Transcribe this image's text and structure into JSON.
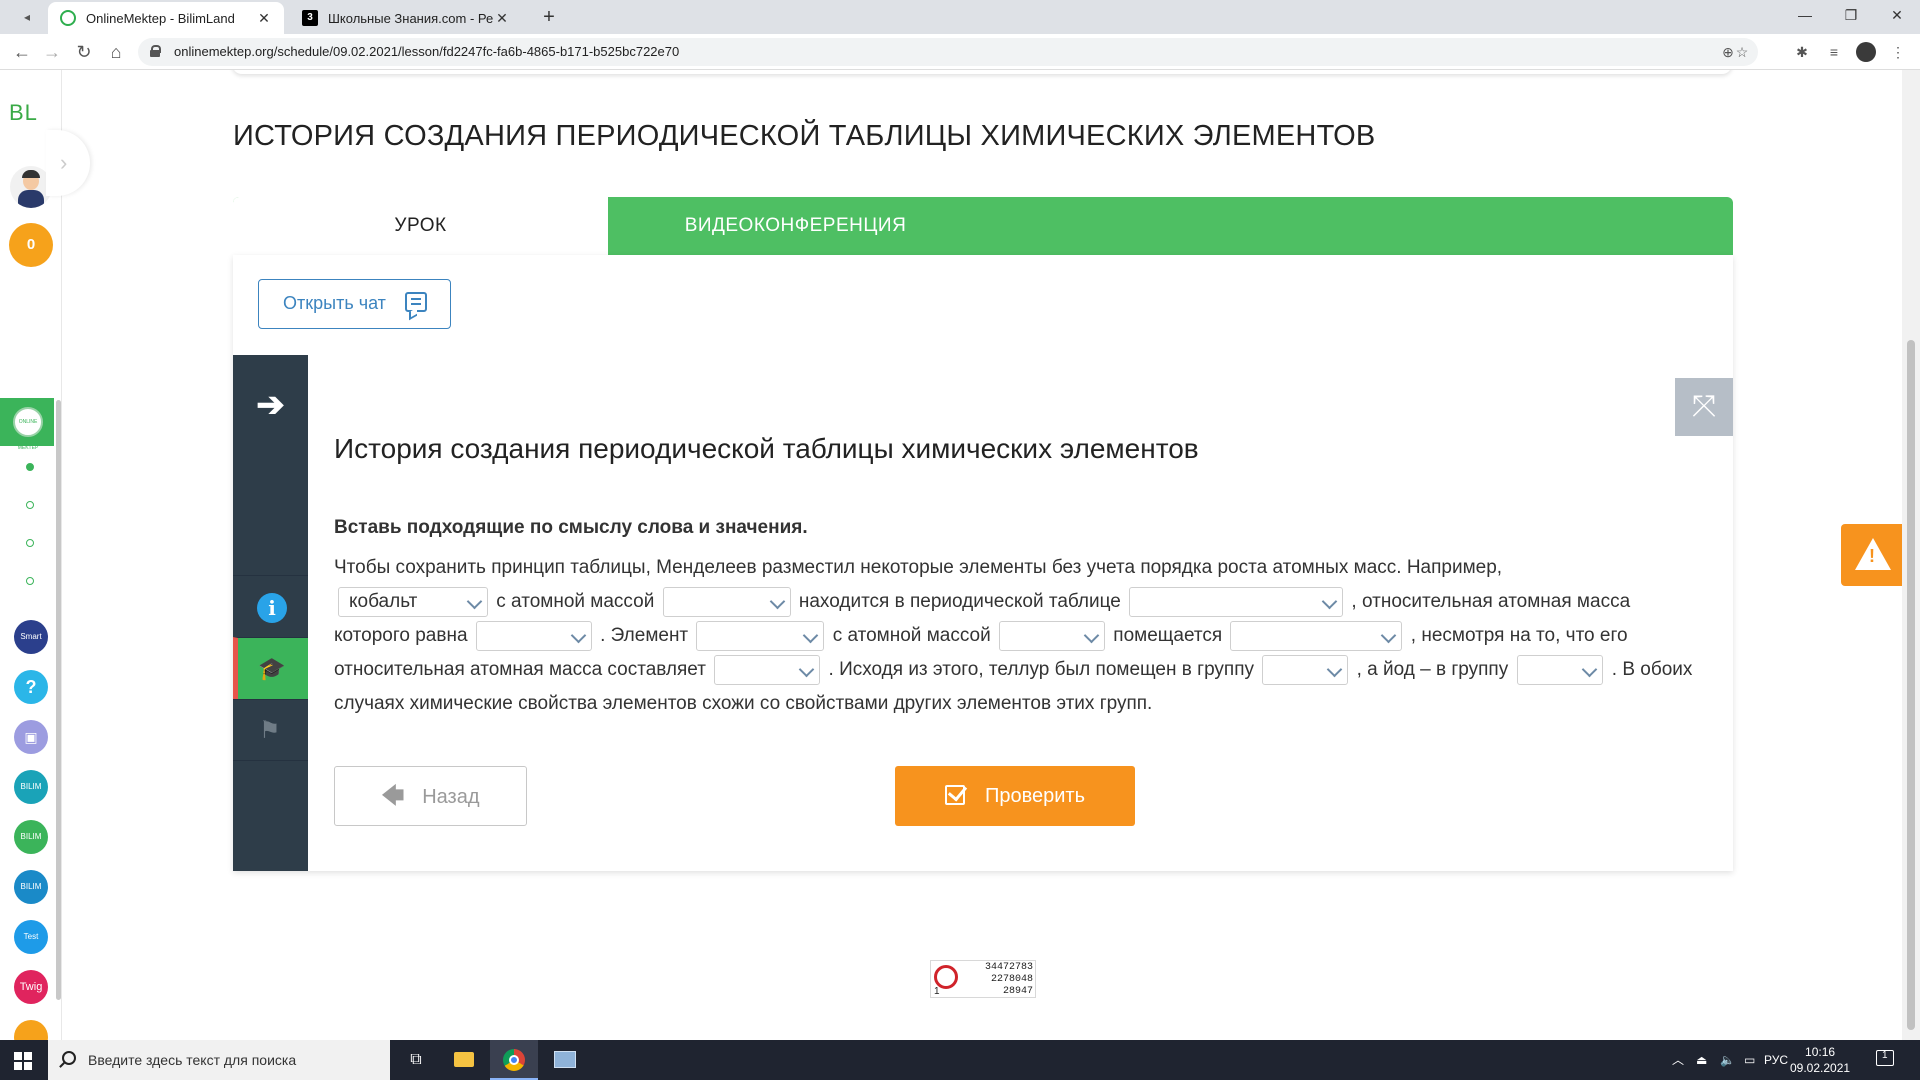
{
  "browser": {
    "tabs": [
      {
        "title": "OnlineMektep - BilimLand",
        "active": true
      },
      {
        "title": "Школьные Знания.com - Решае",
        "active": false
      }
    ],
    "url": "onlinemektep.org/schedule/09.02.2021/lesson/fd2247fc-fa6b-4865-b171-b525bc722e70"
  },
  "sidebar": {
    "logo": "BL",
    "coins": "0",
    "active_app_label": "ONLINE MEKTEP",
    "apps": [
      "Smart Nation",
      "?",
      "▣",
      "BILIM Class",
      "BILIM Land",
      "BILIM Book",
      "Test",
      "Twig"
    ]
  },
  "lesson": {
    "title": "ИСТОРИЯ СОЗДАНИЯ ПЕРИОДИЧЕСКОЙ ТАБЛИЦЫ ХИМИЧЕСКИХ ЭЛЕМЕНТОВ",
    "tab_lesson": "УРОК",
    "tab_video": "ВИДЕОКОНФЕРЕНЦИЯ",
    "chat_button": "Открыть чат"
  },
  "task": {
    "title": "История создания периодической таблицы химических элементов",
    "instruction": "Вставь подходящие по смыслу слова и значения.",
    "segments": {
      "s1": "Чтобы сохранить принцип таблицы, Менделеев разместил некоторые элементы без учета порядка роста атомных масс. Например,",
      "s2": "с атомной массой",
      "s3": "находится в периодической таблице",
      "s4": ", относительная атомная масса которого равна",
      "s5": ". Элемент",
      "s6": "с атомной массой",
      "s7": "помещается",
      "s8": ", несмотря на то, что его относительная атомная масса составляет",
      "s9": ". Исходя из этого, теллур был помещен в группу",
      "s10": ", а йод – в группу",
      "s11": ". В обоих случаях химические свойства элементов схожи со свойствами других элементов этих групп."
    },
    "dropdowns": {
      "d1": "кобальт",
      "d2": "",
      "d3": "",
      "d4": "",
      "d5": "",
      "d6": "",
      "d7": "",
      "d8": "",
      "d9": "",
      "d10": ""
    },
    "back_button": "Назад",
    "check_button": "Проверить"
  },
  "counter": {
    "line1": "34472783",
    "line2": "2278048",
    "line3": "28947",
    "small": "1"
  },
  "taskbar": {
    "search_placeholder": "Введите здесь текст для поиска",
    "lang": "РУС",
    "time": "10:16",
    "date": "09.02.2021",
    "notif_count": "1"
  },
  "colors": {
    "green": "#4ebf63",
    "orange": "#f7931e",
    "dark": "#2e3d49",
    "blue": "#3c84bf"
  }
}
